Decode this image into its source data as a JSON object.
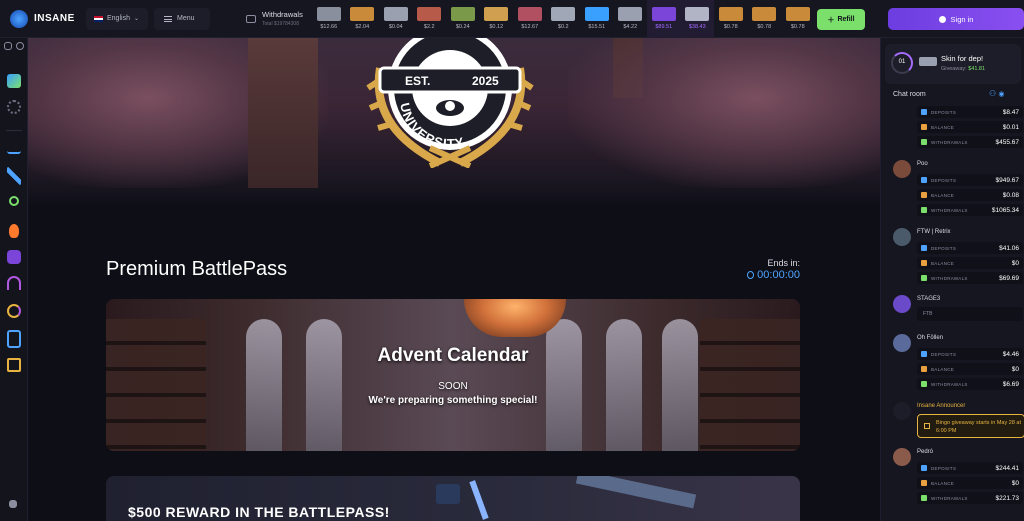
{
  "brand": {
    "name": "INSANE"
  },
  "topbar": {
    "language": "English",
    "menu_label": "Menu",
    "withdrawals_title": "Withdrawals",
    "withdrawals_sub": "Total $19784308",
    "feed_prices": [
      "$12.66",
      "$2.04",
      "$0.04",
      "$2.2",
      "$0.24",
      "$0.12",
      "$12.67",
      "$0.2",
      "$15.51",
      "$4.22",
      "$89.51",
      "$38.43",
      "$0.78",
      "$0.78",
      "$0.78"
    ],
    "refill_label": "Refill",
    "signin_label": "Sign in"
  },
  "main": {
    "emblem_est": "EST.",
    "emblem_year": "2025",
    "emblem_word": "UNIVERSITY",
    "page_title": "Premium BattlePass",
    "ends_label": "Ends in:",
    "timer": "00:00:00",
    "advent_title": "Advent Calendar",
    "advent_soon": "SOON",
    "advent_sub": "We're preparing something special!",
    "reward_title": "$500 REWARD IN THE BATTLEPASS!"
  },
  "promo": {
    "level": "01",
    "title": "Skin for dep!",
    "giveaway_label": "Giveaway:",
    "giveaway_value": "$41.81"
  },
  "chat": {
    "title": "Chat room",
    "labels": {
      "deposits": "DEPOSITS",
      "balance": "BALANCE",
      "withdrawals": "WITHDRAWALS"
    },
    "messages": [
      {
        "name": "",
        "deposits": "$8.47",
        "balance": "$0.01",
        "withdrawals": "$455.67"
      },
      {
        "name": "Poo",
        "deposits": "$949.67",
        "balance": "$0.08",
        "withdrawals": "$1065.34"
      },
      {
        "name": "FTW | Retrix",
        "deposits": "$41.06",
        "balance": "$0",
        "withdrawals": "$69.69"
      },
      {
        "name": "STAGE3",
        "text": "FTB"
      },
      {
        "name": "Oh Föllen",
        "deposits": "$4.46",
        "balance": "$0",
        "withdrawals": "$6.69"
      },
      {
        "name": "Insane Announcer",
        "text": "Bingo giveaway starts in May 28 at 6:00 PM"
      },
      {
        "name": "Pedró",
        "deposits": "$244.41",
        "balance": "$0",
        "withdrawals": "$221.73"
      }
    ]
  },
  "colors": {
    "accent_purple": "#7c45ea",
    "accent_green": "#7be06b",
    "accent_blue": "#4da3ff",
    "announce_gold": "#e8b340"
  }
}
